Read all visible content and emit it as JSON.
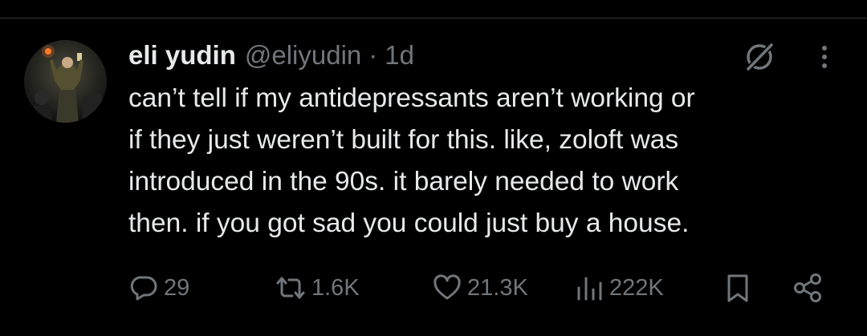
{
  "tweet": {
    "display_name": "eli yudin",
    "handle": "@eliyudin",
    "separator": "·",
    "time": "1d",
    "text": "can’t tell if my antidepressants aren’t working or\nif they just weren’t built for this. like, zoloft was\nintroduced in the 90s. it barely needed to work\nthen. if you got sad you could just buy a house."
  },
  "actions": {
    "replies": "29",
    "reposts": "1.6K",
    "likes": "21.3K",
    "views": "222K"
  },
  "icons": {
    "header": [
      "grok-icon",
      "more-icon"
    ],
    "actions": [
      "reply-icon",
      "repost-icon",
      "like-icon",
      "views-icon",
      "bookmark-icon",
      "share-icon"
    ]
  },
  "colors": {
    "background": "#000000",
    "primary_text": "#e7e9ea",
    "secondary_text": "#71767b",
    "divider": "#2f3336"
  }
}
